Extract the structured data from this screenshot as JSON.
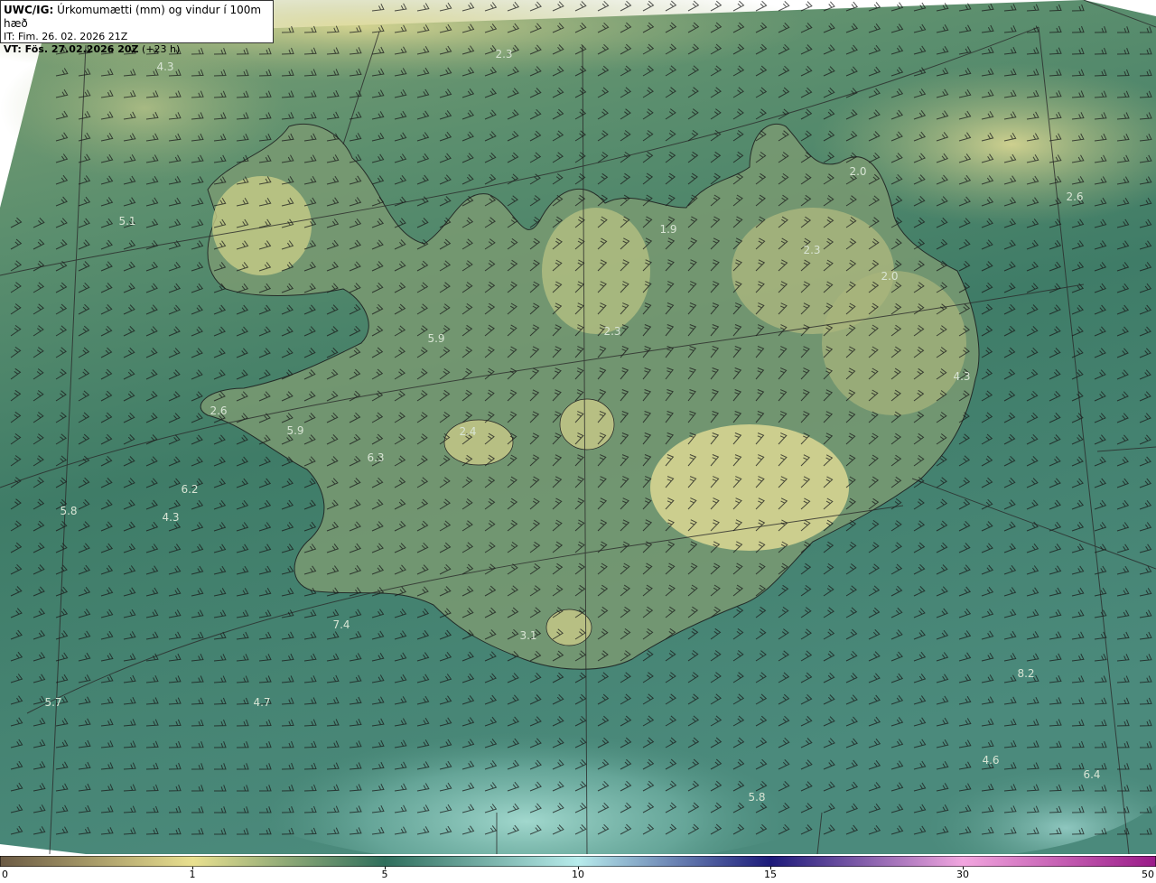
{
  "header": {
    "model": "UWC/IG:",
    "title": "Úrkomumætti (mm) og vindur í 100m hæð",
    "init_time": "IT: Fim. 26. 02. 2026 21Z",
    "valid_label": "VT: Fös. 27.02.2026 20Z",
    "lead": "(+23 h)"
  },
  "colorbar": {
    "ticks": [
      "0",
      "1",
      "5",
      "10",
      "15",
      "30",
      "50"
    ],
    "colors": {
      "c0": "#6b5a44",
      "c1": "#e9e08f",
      "c5": "#2f6e5c",
      "c10": "#b8ecec",
      "c15": "#1c1a7a",
      "c30": "#f2a6df",
      "c50": "#9a1a88"
    }
  },
  "map": {
    "values": [
      {
        "text": "4.3"
      },
      {
        "text": "2.3"
      },
      {
        "text": "5.1"
      },
      {
        "text": "2.0"
      },
      {
        "text": "2.6"
      },
      {
        "text": "1.9"
      },
      {
        "text": "2.3"
      },
      {
        "text": "2.0"
      },
      {
        "text": "5.9"
      },
      {
        "text": "2.3"
      },
      {
        "text": "4.3"
      },
      {
        "text": "2.6"
      },
      {
        "text": "5.9"
      },
      {
        "text": "2.4"
      },
      {
        "text": "6.3"
      },
      {
        "text": "6.2"
      },
      {
        "text": "5.8"
      },
      {
        "text": "4.3"
      },
      {
        "text": "7.4"
      },
      {
        "text": "3.1"
      },
      {
        "text": "5.7"
      },
      {
        "text": "4.7"
      },
      {
        "text": "8.2"
      },
      {
        "text": "4.6"
      },
      {
        "text": "6.4"
      },
      {
        "text": "5.8"
      }
    ]
  }
}
